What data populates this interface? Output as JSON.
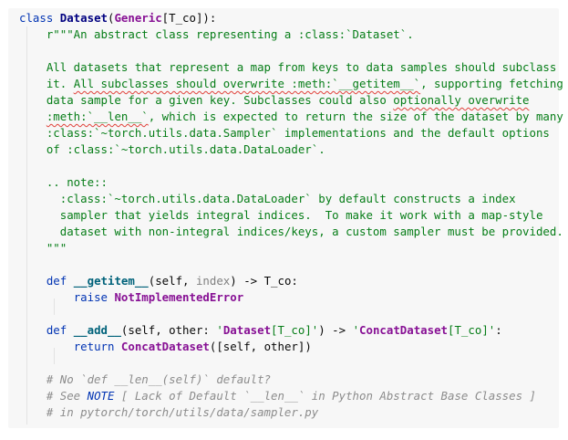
{
  "editor": {
    "lines": [
      {
        "segments": [
          {
            "t": "class ",
            "c": "kw"
          },
          {
            "t": "Dataset",
            "c": "kw2"
          },
          {
            "t": "(",
            "c": ""
          },
          {
            "t": "Generic",
            "c": "cls"
          },
          {
            "t": "[T_co]):",
            "c": ""
          }
        ]
      },
      {
        "segments": [
          {
            "t": "    r\"\"\"An abstract class representing a :class:`Dataset`.",
            "c": "str"
          }
        ]
      },
      {
        "segments": []
      },
      {
        "segments": [
          {
            "t": "    All datasets that represent a map from keys to data samples should subclass",
            "c": "str"
          }
        ]
      },
      {
        "segments": [
          {
            "t": "    it. ",
            "c": "str"
          },
          {
            "t": "All subclasses should overwrite :meth:`__getitem__`",
            "c": "str err"
          },
          {
            "t": ", supporting fetching a",
            "c": "str"
          }
        ]
      },
      {
        "segments": [
          {
            "t": "    data sample for a given key. Subclasses could also ",
            "c": "str"
          },
          {
            "t": "optionally overwrite",
            "c": "str err"
          }
        ]
      },
      {
        "segments": [
          {
            "t": "    ",
            "c": "str"
          },
          {
            "t": ":meth:`__len__`",
            "c": "str err"
          },
          {
            "t": ", which is expected to return the size of the dataset by many",
            "c": "str"
          }
        ]
      },
      {
        "segments": [
          {
            "t": "    :class:`~torch.utils.data.Sampler` implementations and the default options",
            "c": "str"
          }
        ]
      },
      {
        "segments": [
          {
            "t": "    of :class:`~torch.utils.data.DataLoader`.",
            "c": "str"
          }
        ]
      },
      {
        "segments": []
      },
      {
        "segments": [
          {
            "t": "    .. note::",
            "c": "str"
          }
        ]
      },
      {
        "segments": [
          {
            "t": "      :class:`~torch.utils.data.DataLoader` by default constructs a index",
            "c": "str"
          }
        ]
      },
      {
        "segments": [
          {
            "t": "      sampler that yields integral indices.  To make it work with a map-style",
            "c": "str"
          }
        ]
      },
      {
        "segments": [
          {
            "t": "      dataset with non-integral indices/keys, a custom sampler must be provided.",
            "c": "str"
          }
        ]
      },
      {
        "segments": [
          {
            "t": "    \"\"\"",
            "c": "str"
          }
        ]
      },
      {
        "segments": []
      },
      {
        "segments": [
          {
            "t": "    ",
            "c": ""
          },
          {
            "t": "def ",
            "c": "kw"
          },
          {
            "t": "__getitem__",
            "c": "fn"
          },
          {
            "t": "(self, ",
            "c": ""
          },
          {
            "t": "index",
            "c": "param"
          },
          {
            "t": ") -> T_co:",
            "c": ""
          }
        ]
      },
      {
        "segments": [
          {
            "t": "        ",
            "c": ""
          },
          {
            "t": "raise ",
            "c": "kw"
          },
          {
            "t": "NotImplementedError",
            "c": "cls"
          }
        ]
      },
      {
        "segments": []
      },
      {
        "segments": [
          {
            "t": "    ",
            "c": ""
          },
          {
            "t": "def ",
            "c": "kw"
          },
          {
            "t": "__add__",
            "c": "fn"
          },
          {
            "t": "(self, other: ",
            "c": ""
          },
          {
            "t": "'",
            "c": "str"
          },
          {
            "t": "Dataset",
            "c": "cls"
          },
          {
            "t": "[T_co]'",
            "c": "str"
          },
          {
            "t": ") -> ",
            "c": ""
          },
          {
            "t": "'",
            "c": "str"
          },
          {
            "t": "ConcatDataset",
            "c": "cls"
          },
          {
            "t": "[T_co]'",
            "c": "str"
          },
          {
            "t": ":",
            "c": ""
          }
        ]
      },
      {
        "segments": [
          {
            "t": "        ",
            "c": ""
          },
          {
            "t": "return ",
            "c": "kw"
          },
          {
            "t": "ConcatDataset",
            "c": "cls"
          },
          {
            "t": "([self, other])",
            "c": ""
          }
        ]
      },
      {
        "segments": []
      },
      {
        "segments": [
          {
            "t": "    # No `def __len__(self)` default?",
            "c": "cmt"
          }
        ]
      },
      {
        "segments": [
          {
            "t": "    # See ",
            "c": "cmt"
          },
          {
            "t": "NOTE",
            "c": "note"
          },
          {
            "t": " [ Lack of Default `__len__` in Python Abstract Base Classes ]",
            "c": "cmt"
          }
        ]
      },
      {
        "segments": [
          {
            "t": "    # in pytorch/torch/utils/data/sampler.py",
            "c": "cmt"
          }
        ]
      }
    ]
  }
}
